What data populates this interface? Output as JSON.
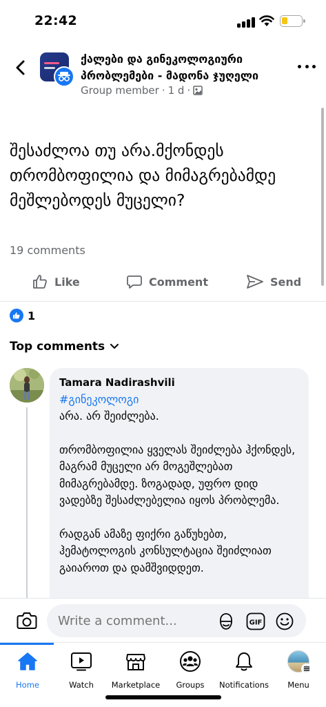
{
  "status_bar": {
    "time": "22:42"
  },
  "header": {
    "group_name": "ქალები და გინეკოლოგიური პრობლემები - მადონა ჯუღელი",
    "meta_role": "Group member",
    "meta_time": "1 d"
  },
  "post": {
    "text": "შესაძლოა თუ არა.მქონდეს თრომბოფილია და მიმაგრებამდე მეშლებოდეს მუცელი?",
    "comment_count": "19 comments",
    "actions": {
      "like": "Like",
      "comment": "Comment",
      "send": "Send"
    },
    "reaction_count": "1"
  },
  "comments_section": {
    "title": "Top comments",
    "comment": {
      "author": "Tamara  Nadirashvili",
      "hashtag": "#გინეკოლოგი",
      "paragraphs": [
        "არა. არ შეიძლება.",
        "თრომბოფილია ყველას შეიძლება ჰქონდეს, მაგრამ მუცელი არ მოგეშლებათ მიმაგრებამდე. ზოგადად, უფრო დიდ ვადებზე შესაძლებელია იყოს პრობლემა.",
        "რადგან ამაზე ფიქრი გაწუხებთ, ჰემატოლოგის კონსულტაცია შეიძლიათ გაიაროთ და დამშვიდდეთ."
      ]
    }
  },
  "composer": {
    "placeholder": "Write a comment..."
  },
  "tabs": [
    {
      "label": "Home",
      "icon": "home-icon"
    },
    {
      "label": "Watch",
      "icon": "watch-icon"
    },
    {
      "label": "Marketplace",
      "icon": "marketplace-icon"
    },
    {
      "label": "Groups",
      "icon": "groups-icon"
    },
    {
      "label": "Notifications",
      "icon": "bell-icon"
    },
    {
      "label": "Menu",
      "icon": "profile-avatar"
    }
  ],
  "colors": {
    "accent": "#1877f2",
    "secondary_text": "#65676b",
    "bubble": "#f0f2f5"
  }
}
